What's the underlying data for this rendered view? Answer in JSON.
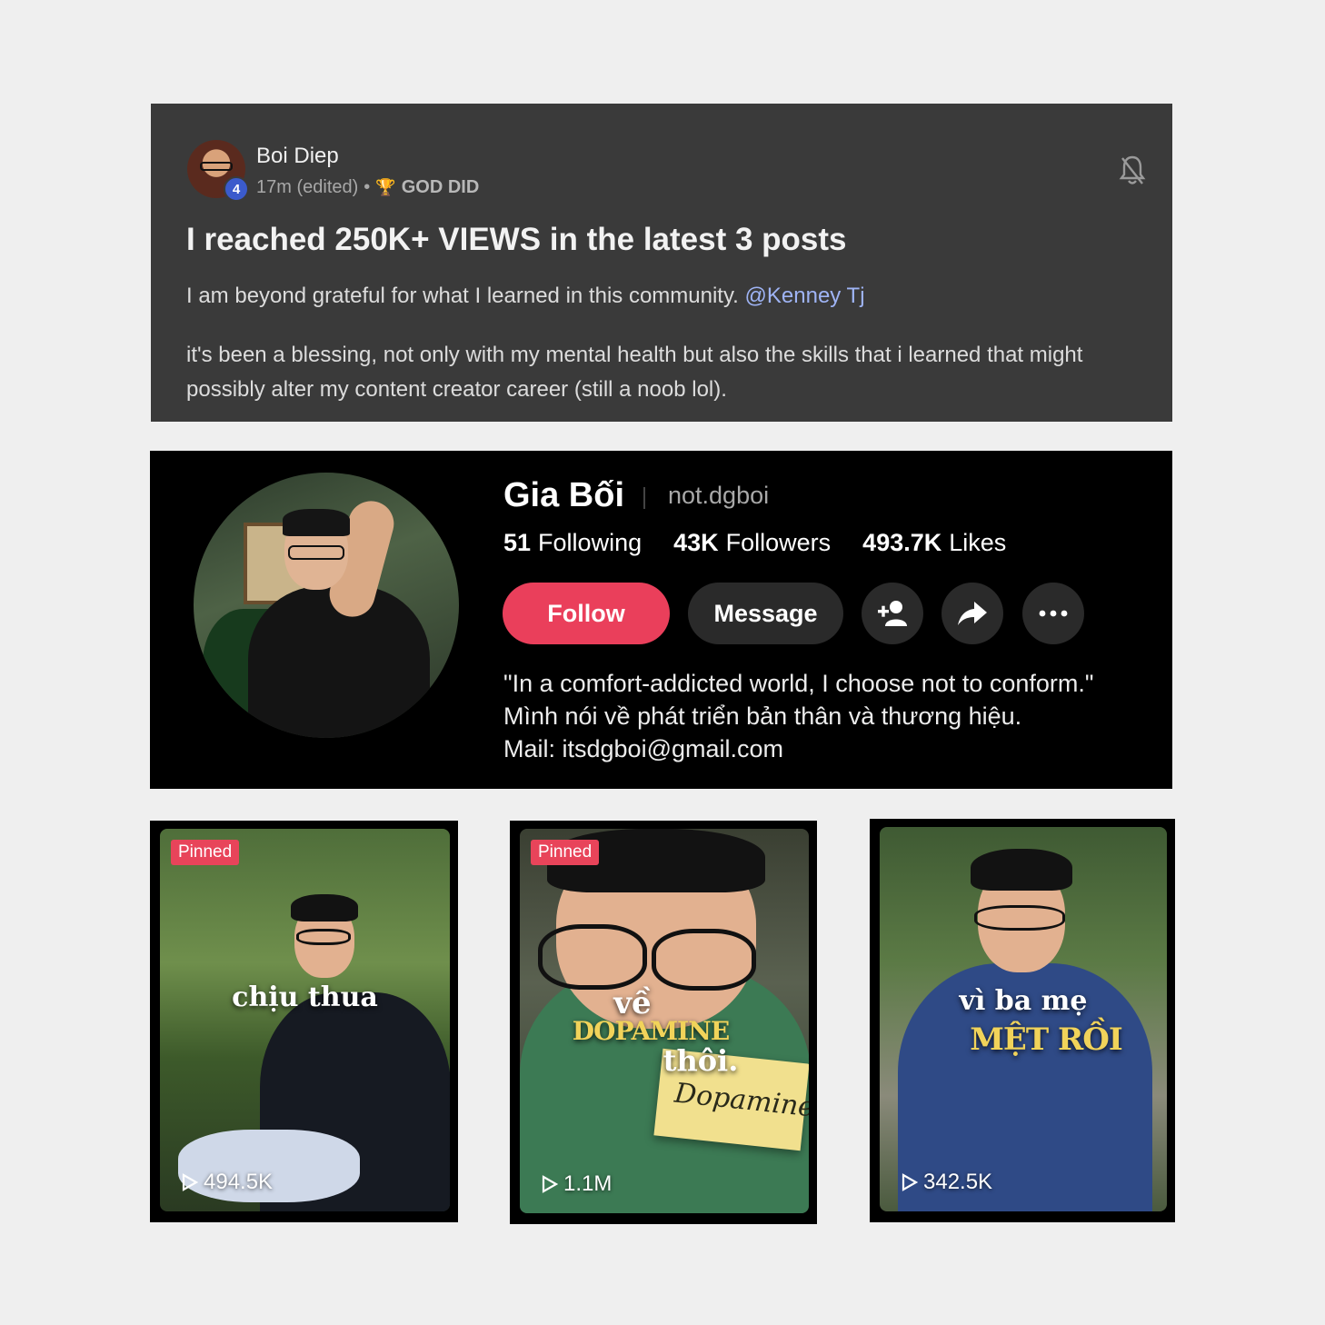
{
  "post": {
    "author": "Boi Diep",
    "level": "4",
    "time": "17m (edited)",
    "dot": "•",
    "rank_icon": "trophy-icon",
    "rank": "GOD DID",
    "title": "I reached 250K+ VIEWS in the latest 3 posts",
    "line1_text": "I am beyond grateful for what I learned in this community.",
    "mention": "@Kenney Tj",
    "line2_text": "it's been a blessing, not only with my mental health but also the skills that i learned that might possibly alter my content creator career (still a noob lol)."
  },
  "profile": {
    "name": "Gia Bối",
    "handle": "not.dgboi",
    "following_count": "51",
    "following_label": "Following",
    "followers_count": "43K",
    "followers_label": "Followers",
    "likes_count": "493.7K",
    "likes_label": "Likes",
    "follow_label": "Follow",
    "message_label": "Message",
    "bio": [
      "\"In a comfort-addicted world, I choose not to conform.\"",
      "Mình nói về phát triển bản thân và thương hiệu.",
      "Mail: itsdgboi@gmail.com"
    ],
    "accent_color": "#ea3f5b"
  },
  "videos": [
    {
      "pinned": "Pinned",
      "caption": "chịu thua",
      "views": "494.5K"
    },
    {
      "pinned": "Pinned",
      "caption_top": "về",
      "caption_gold": "DOPAMINE",
      "caption_bottom": "thôi.",
      "note": "Dopamine",
      "views": "1.1M"
    },
    {
      "caption_top": "vì ba mẹ",
      "caption_gold": "MỆT RỒI",
      "views": "342.5K"
    }
  ]
}
